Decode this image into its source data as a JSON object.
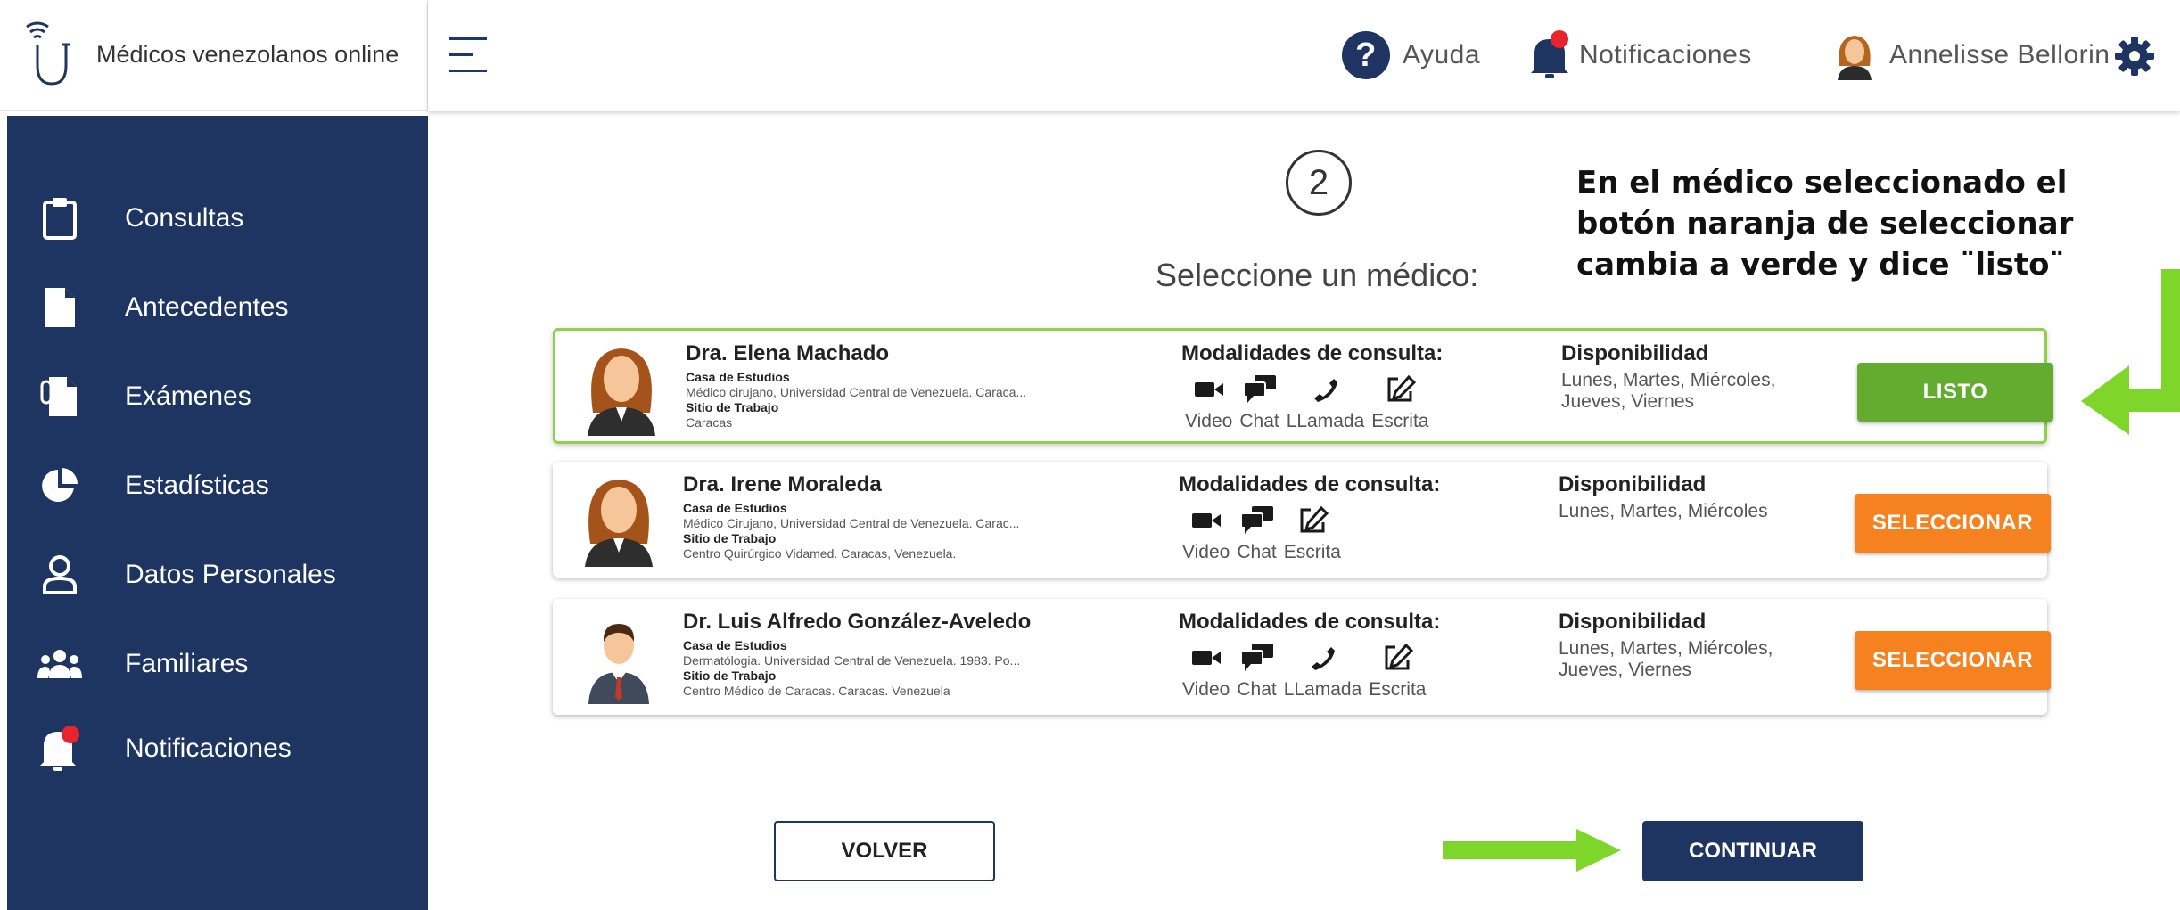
{
  "brand": {
    "name": "Médicos venezolanos online"
  },
  "header": {
    "help_label": "Ayuda",
    "notifications_label": "Notificaciones",
    "user_name": "Annelisse Bellorin"
  },
  "sidebar": {
    "items": [
      {
        "label": "Consultas",
        "icon": "clipboard-icon"
      },
      {
        "label": "Antecedentes",
        "icon": "document-icon"
      },
      {
        "label": "Exámenes",
        "icon": "lab-report-icon"
      },
      {
        "label": "Estadísticas",
        "icon": "pie-chart-icon"
      },
      {
        "label": "Datos Personales",
        "icon": "user-icon"
      },
      {
        "label": "Familiares",
        "icon": "family-icon"
      },
      {
        "label": "Notificaciones",
        "icon": "bell-icon"
      }
    ]
  },
  "main": {
    "step": "2",
    "subtitle": "Seleccione un médico:",
    "annotation": "En el médico seleccionado el botón naranja de seleccionar cambia a verde y dice ¨listo¨",
    "modalities_title": "Modalidades de consulta:",
    "availability_title": "Disponibilidad",
    "studies_label": "Casa de Estudios",
    "work_label": "Sitio de Trabajo",
    "modality_labels": {
      "video": "Video",
      "chat": "Chat",
      "call": "LLamada",
      "written": "Escrita"
    },
    "doctors": [
      {
        "name": "Dra. Elena Machado",
        "studies": "Médico cirujano, Universidad Central de Venezuela. Caraca...",
        "work": "Caracas",
        "availability": "Lunes, Martes, Miércoles, Jueves, Viernes",
        "button": "LISTO",
        "selected": true
      },
      {
        "name": "Dra. Irene Moraleda",
        "studies": "Médico Cirujano, Universidad Central de Venezuela. Carac...",
        "work": "Centro Quirúrgico Vidamed. Caracas, Venezuela.",
        "availability": "Lunes, Martes, Miércoles",
        "button": "SELECCIONAR",
        "selected": false
      },
      {
        "name": "Dr. Luis Alfredo González-Aveledo",
        "studies": "Dermatólogia. Universidad Central de Venezuela. 1983. Po...",
        "work": "Centro Médico de Caracas. Caracas. Venezuela",
        "availability": "Lunes, Martes, Miércoles, Jueves, Viernes",
        "button": "SELECCIONAR",
        "selected": false
      }
    ],
    "back_button": "VOLVER",
    "continue_button": "CONTINUAR"
  },
  "colors": {
    "sidebar_bg": "#1e3461",
    "selected_green": "#63ac30",
    "select_orange": "#f5811f",
    "arrow_green": "#7fd62a",
    "notification_red": "#e8242c"
  }
}
